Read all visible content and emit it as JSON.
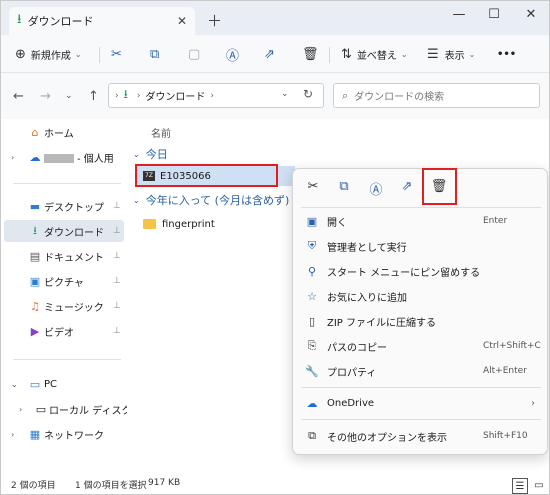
{
  "tab": {
    "title": "ダウンロード",
    "close": "✕",
    "new": "＋"
  },
  "window_controls": {
    "minimize": "—",
    "maximize": "☐",
    "close": "✕"
  },
  "toolbar": {
    "new_label": "新規作成",
    "sort_label": "並べ替え",
    "view_label": "表示",
    "more_label": "•••"
  },
  "address": {
    "path": [
      "ダウンロード"
    ],
    "search_placeholder": "ダウンロードの検索"
  },
  "sidebar": {
    "items": [
      {
        "label": "ホーム",
        "icon": "home-icon"
      },
      {
        "label": "- 個人用",
        "icon": "onedrive-icon"
      },
      {
        "label": "デスクトップ",
        "icon": "desktop-icon"
      },
      {
        "label": "ダウンロード",
        "icon": "download-icon"
      },
      {
        "label": "ドキュメント",
        "icon": "documents-icon"
      },
      {
        "label": "ピクチャ",
        "icon": "pictures-icon"
      },
      {
        "label": "ミュージック",
        "icon": "music-icon"
      },
      {
        "label": "ビデオ",
        "icon": "videos-icon"
      },
      {
        "label": "PC",
        "icon": "pc-icon"
      },
      {
        "label": "ローカル ディスク (C:)",
        "icon": "drive-icon"
      },
      {
        "label": "ネットワーク",
        "icon": "network-icon"
      }
    ]
  },
  "main": {
    "column_name": "名前",
    "groups": [
      {
        "label": "今日",
        "files": [
          {
            "name": "E1035066",
            "icon_text": "7Z"
          }
        ]
      },
      {
        "label": "今年に入って (今月は含めず)",
        "files": [
          {
            "name": "fingerprint"
          }
        ]
      }
    ]
  },
  "context_menu": {
    "items": [
      {
        "label": "開く",
        "shortcut": "Enter",
        "icon": "open-icon"
      },
      {
        "label": "管理者として実行",
        "shortcut": "",
        "icon": "shield-icon"
      },
      {
        "label": "スタート メニューにピン留めする",
        "shortcut": "",
        "icon": "pin-icon"
      },
      {
        "label": "お気に入りに追加",
        "shortcut": "",
        "icon": "star-icon"
      },
      {
        "label": "ZIP ファイルに圧縮する",
        "shortcut": "",
        "icon": "zip-icon"
      },
      {
        "label": "パスのコピー",
        "shortcut": "Ctrl+Shift+C",
        "icon": "copy-path-icon"
      },
      {
        "label": "プロパティ",
        "shortcut": "Alt+Enter",
        "icon": "wrench-icon"
      },
      {
        "label": "OneDrive",
        "shortcut": "",
        "icon": "onedrive-icon"
      },
      {
        "label": "その他のオプションを表示",
        "shortcut": "Shift+F10",
        "icon": "more-options-icon"
      }
    ]
  },
  "status": {
    "item_count": "2 個の項目",
    "selected": "1 個の項目を選択",
    "size": "917 KB"
  },
  "colors": {
    "highlight": "#e02020",
    "selection": "#cfe0f4",
    "accent": "#2c5fa8"
  }
}
